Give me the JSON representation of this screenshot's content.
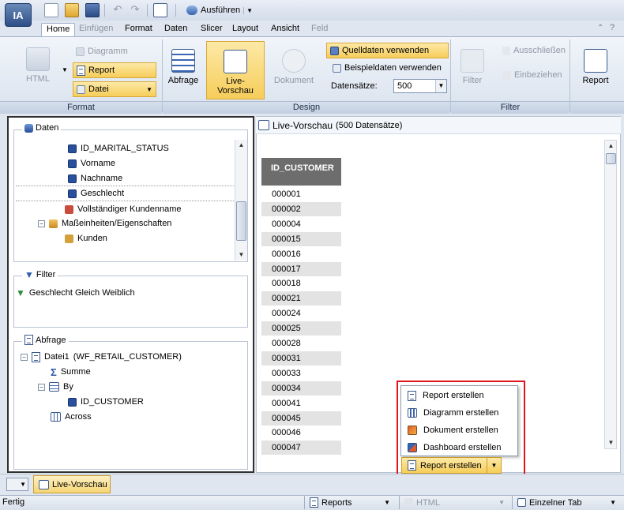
{
  "app": {
    "logo": "IA"
  },
  "qat": {
    "run_label": "Ausführen"
  },
  "tabs": [
    {
      "label": "Home",
      "active": true,
      "disabled": false
    },
    {
      "label": "Einfügen",
      "active": false,
      "disabled": true
    },
    {
      "label": "Format",
      "active": false,
      "disabled": false
    },
    {
      "label": "Daten",
      "active": false,
      "disabled": false
    },
    {
      "label": "Slicer",
      "active": false,
      "disabled": false
    },
    {
      "label": "Layout",
      "active": false,
      "disabled": false
    },
    {
      "label": "Ansicht",
      "active": false,
      "disabled": false
    },
    {
      "label": "Feld",
      "active": false,
      "disabled": true
    }
  ],
  "ribbon": {
    "format_group": {
      "label": "Format",
      "html": "HTML",
      "diagramm": "Diagramm",
      "report": "Report",
      "datei": "Datei"
    },
    "design_group": {
      "label": "Design",
      "abfrage": "Abfrage",
      "live_vorschau_line1": "Live-",
      "live_vorschau_line2": "Vorschau",
      "dokument": "Dokument",
      "quelldaten": "Quelldaten verwenden",
      "beispieldaten": "Beispieldaten verwenden",
      "datensaetze_label": "Datensätze:",
      "datensaetze_value": "500"
    },
    "filter_group": {
      "label": "Filter",
      "filter": "Filter",
      "ausschliessen": "Ausschließen",
      "einbeziehen": "Einbeziehen",
      "report": "Report"
    }
  },
  "daten_panel": {
    "title": "Daten",
    "items": [
      {
        "label": "ID_MARITAL_STATUS"
      },
      {
        "label": "Vorname"
      },
      {
        "label": "Nachname"
      },
      {
        "label": "Geschlecht"
      },
      {
        "label": "Vollständiger Kundenname"
      },
      {
        "label": "Maßeinheiten/Eigenschaften"
      },
      {
        "label": "Kunden"
      }
    ]
  },
  "filter_panel": {
    "title": "Filter",
    "condition": "Geschlecht Gleich Weiblich"
  },
  "abfrage_panel": {
    "title": "Abfrage",
    "datei_name": "Datei1",
    "datei_source": "(WF_RETAIL_CUSTOMER)",
    "summe": "Summe",
    "by": "By",
    "by_field": "ID_CUSTOMER",
    "across": "Across"
  },
  "preview": {
    "title": "Live-Vorschau",
    "subtitle": "(500 Datensätze)",
    "column": "ID_CUSTOMER",
    "rows": [
      "000001",
      "000002",
      "000004",
      "000015",
      "000016",
      "000017",
      "000018",
      "000021",
      "000024",
      "000025",
      "000028",
      "000031",
      "000033",
      "000034",
      "000041",
      "000045",
      "000046",
      "000047"
    ]
  },
  "popup_menu": {
    "items": [
      {
        "label": "Report erstellen"
      },
      {
        "label": "Diagramm erstellen"
      },
      {
        "label": "Dokument erstellen"
      },
      {
        "label": "Dashboard erstellen"
      }
    ]
  },
  "split_button": {
    "label": "Report erstellen"
  },
  "bottom_tab": {
    "label": "Live-Vorschau"
  },
  "status": {
    "text": "Fertig",
    "dd1": "Reports",
    "dd2": "HTML",
    "dd3": "Einzelner Tab"
  }
}
